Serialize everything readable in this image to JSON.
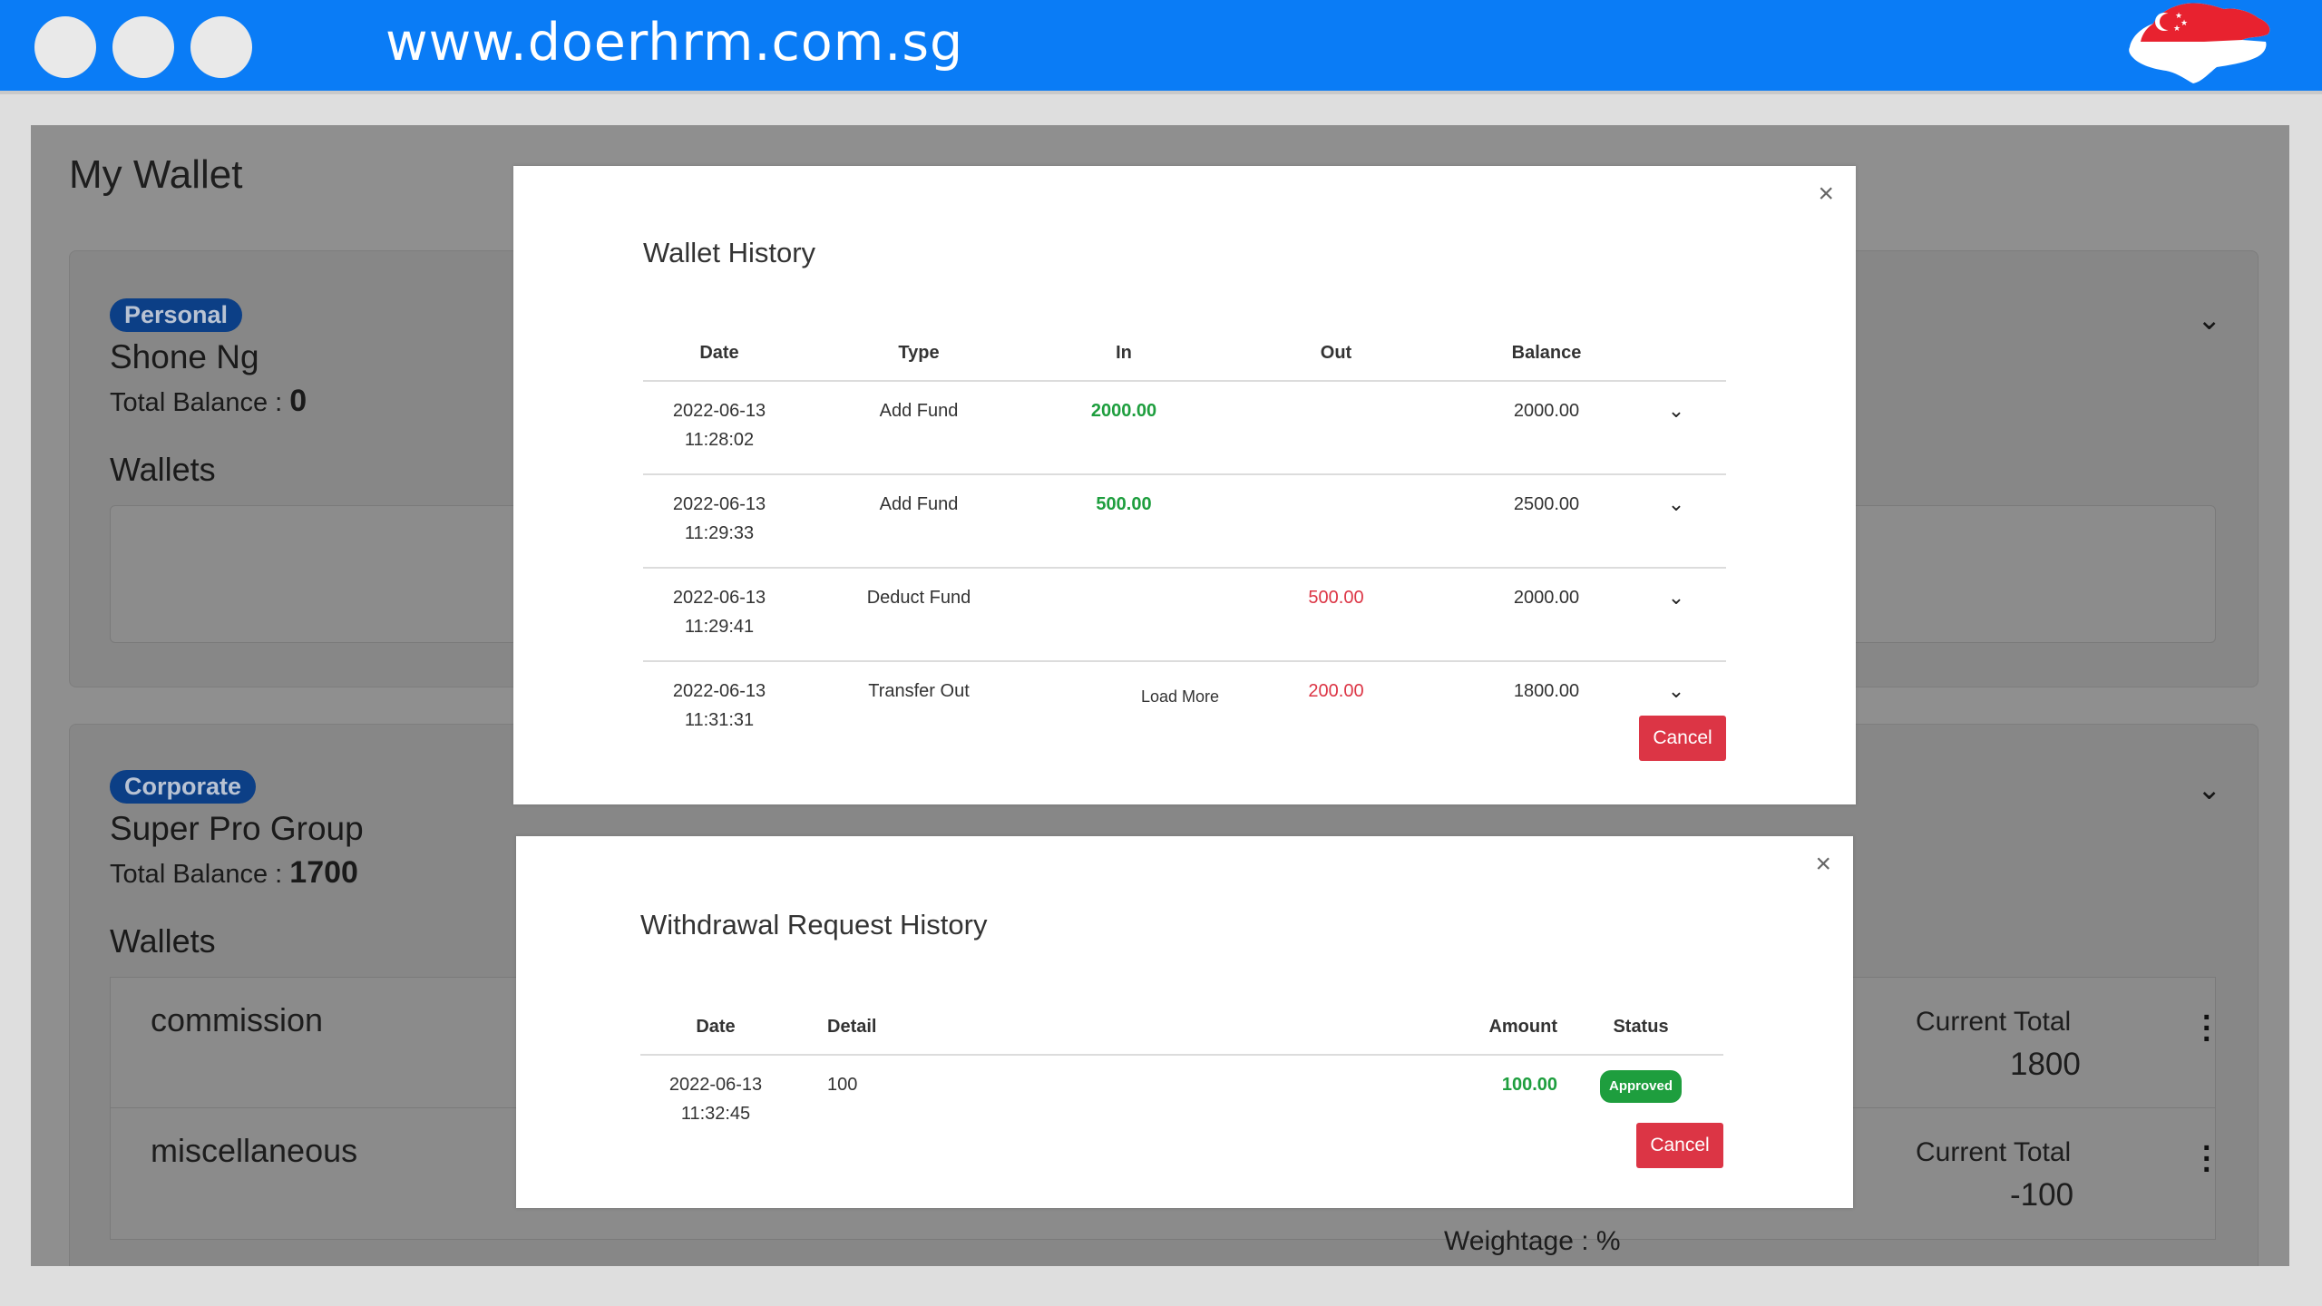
{
  "browser": {
    "url": "www.doerhrm.com.sg",
    "flag_icon": "singapore-map-flag-icon"
  },
  "page": {
    "title": "My Wallet",
    "personal": {
      "badge": "Personal",
      "name": "Shone Ng",
      "balance_label": "Total Balance :",
      "balance_value": "0",
      "wallets_label": "Wallets"
    },
    "corporate": {
      "badge": "Corporate",
      "name": "Super Pro Group",
      "balance_label": "Total Balance :",
      "balance_value": "1700",
      "wallets_label": "Wallets",
      "wallets": [
        {
          "name": "commission",
          "total_label": "Current Total",
          "total": "1800"
        },
        {
          "name": "miscellaneous",
          "total_label": "Current Total",
          "total": "-100"
        }
      ],
      "partial_text": "Weightage : %"
    }
  },
  "wallet_history": {
    "title": "Wallet History",
    "close": "×",
    "columns": [
      "Date",
      "Type",
      "In",
      "Out",
      "Balance"
    ],
    "rows": [
      {
        "date": "2022-06-13",
        "time": "11:28:02",
        "type": "Add Fund",
        "in": "2000.00",
        "out": "",
        "balance": "2000.00"
      },
      {
        "date": "2022-06-13",
        "time": "11:29:33",
        "type": "Add Fund",
        "in": "500.00",
        "out": "",
        "balance": "2500.00"
      },
      {
        "date": "2022-06-13",
        "time": "11:29:41",
        "type": "Deduct Fund",
        "in": "",
        "out": "500.00",
        "balance": "2000.00"
      },
      {
        "date": "2022-06-13",
        "time": "11:31:31",
        "type": "Transfer Out",
        "in": "",
        "out": "200.00",
        "balance": "1800.00"
      }
    ],
    "load_more": "Load More",
    "cancel": "Cancel"
  },
  "withdrawal_history": {
    "title": "Withdrawal Request History",
    "close": "×",
    "columns": [
      "Date",
      "Detail",
      "Amount",
      "Status"
    ],
    "rows": [
      {
        "date": "2022-06-13",
        "time": "11:32:45",
        "detail": "100",
        "amount": "100.00",
        "status": "Approved"
      }
    ],
    "cancel": "Cancel"
  },
  "colors": {
    "topbar": "#0a7cf6",
    "cancel": "#dc3545",
    "in_amount": "#1e9e3e",
    "out_amount": "#dc3545",
    "badge": "#0c3f86"
  }
}
